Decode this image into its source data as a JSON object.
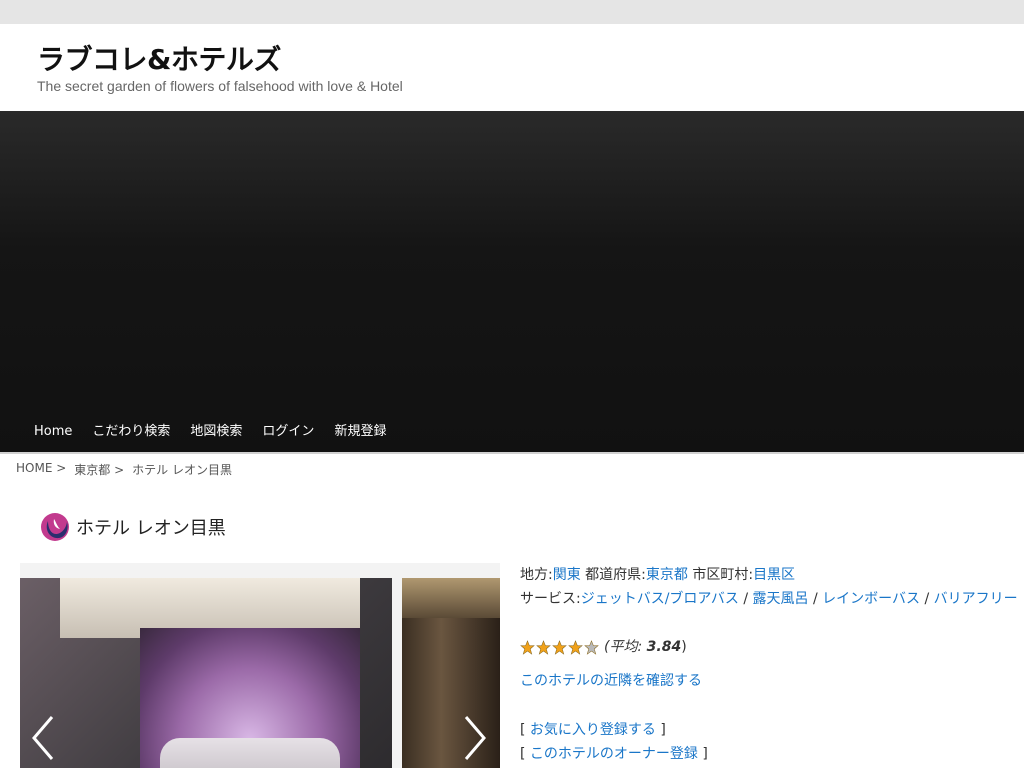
{
  "header": {
    "site_title": "ラブコレ&ホテルズ",
    "site_description": "The secret garden of flowers of falsehood with love & Hotel"
  },
  "nav": {
    "items": [
      "Home",
      "こだわり検索",
      "地図検索",
      "ログイン",
      "新規登録"
    ]
  },
  "breadcrumb": {
    "items": [
      "HOME >",
      "東京都 >",
      "ホテル レオン目黒"
    ]
  },
  "page": {
    "title": "ホテル レオン目黒"
  },
  "info": {
    "region_label": "地方:",
    "region": "関東",
    "prefecture_label": "都道府県:",
    "prefecture": "東京都",
    "city_label": "市区町村:",
    "city": "目黒区",
    "services_label": "サービス:",
    "services": [
      "ジェットバス/ブロアバス",
      "露天風呂",
      "レインボーバス",
      "バリアフリー"
    ],
    "service_separator": "/",
    "rating": 3.84,
    "rating_max": 5,
    "rating_prefix": "(平均: ",
    "rating_value": "3.84",
    "rating_suffix": ")",
    "nearby_link": "このホテルの近隣を確認する",
    "bracket_open": "[",
    "bracket_close": "]",
    "favorite_link": "お気に入り登録する",
    "owner_link": "このホテルのオーナー登録"
  },
  "colors": {
    "link": "#1a76c8",
    "star_fill": "#f0a11a",
    "star_empty": "#b9b9b9"
  },
  "icons": {
    "title": "swirl-logo-icon",
    "prev": "chevron-left-icon",
    "next": "chevron-right-icon",
    "star": "star-icon"
  }
}
